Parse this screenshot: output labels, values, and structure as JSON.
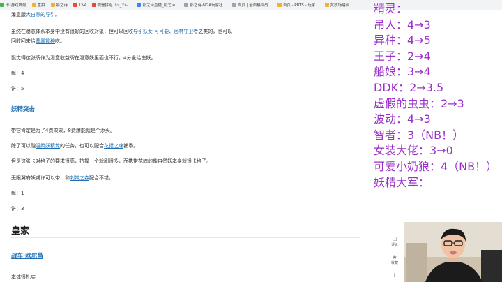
{
  "bookmarks": [
    {
      "label": "卡-游戏牌局",
      "color": "#4caf50"
    },
    {
      "label": "置拍",
      "color": "#f2b134"
    },
    {
      "label": "影之诗",
      "color": "#f2b134"
    },
    {
      "label": "TK2",
      "color": "#e04b3a"
    },
    {
      "label": "微信拼组（~_^)-...",
      "color": "#e04b3a"
    },
    {
      "label": "影之诗直播_影之诗...",
      "color": "#3b82f6"
    },
    {
      "label": "影之诗-NGA玩家社...",
      "color": "#9ca3af"
    },
    {
      "label": "首页 | 全面模拟战...",
      "color": "#9ca3af"
    },
    {
      "label": "首页 - PRTS - 玩家...",
      "color": "#f2b134"
    },
    {
      "label": "竞技场建议...",
      "color": "#f2b134"
    }
  ],
  "article": {
    "line1_pre": "瀑意版",
    "line1_link": "大自然的导引",
    "line1_post": "。",
    "line2_pre": "虽然在瀑意体系本身中没有很好的回收对象，但可以回收",
    "line2_link1": "导引妖女·可可要",
    "line2_mid": "、",
    "line2_link2": "密林守卫者",
    "line2_post": "之类的，也可以",
    "line3_pre": "回收回来给",
    "line3_link": "翡翠锁种",
    "line3_post": "吃。",
    "line4": "飘觉得这张牌作为瀑意收益牌在瀑意妖里面也不行，4分全给虫妖。",
    "score1a": "飘：4",
    "score1b": "饼：5",
    "section1": "妖精突击",
    "line5": "带它肯定是为了4费效果，8费爆能就是个添头。",
    "line6_pre": "除了可以融",
    "line6_link1": "温柔妖精龙",
    "line6_mid": "的任务，也可以配合",
    "line6_link2": "花猎之魂",
    "line6_post": "铺场。",
    "line7": "但是这张卡对格子的要求很高，抗操一个就刷很多，而携带花魂的像自然妖本身就很卡格子。",
    "line8_pre": "无限翼府妖或许可以带，和",
    "line8_link": "刺棘之森",
    "line8_post": "配合不错。",
    "score2a": "飘：1",
    "score2b": "饼：3",
    "section2": "皇家",
    "section3": "战车·欧尔昌",
    "line9": "本体很扎实"
  },
  "rail": [
    {
      "icon": "comment-icon",
      "glyph": "☐",
      "label": "评论"
    },
    {
      "icon": "star-icon",
      "glyph": "★",
      "label": "收藏"
    },
    {
      "icon": "share-icon",
      "glyph": "⇪",
      "label": "分享"
    }
  ],
  "overlay": [
    "精灵：",
    "吊人：4→3",
    "异种：4→5",
    "王子：2→4",
    "船娘：3→4",
    "DDK：2→3.5",
    "虚假的虫虫：2→3",
    "波动：4→3",
    "智者：3（NB！）",
    "女装大佬：3→0",
    "可爱小奶狼：4（NB！）",
    "妖精大军："
  ],
  "colors": {
    "overlay_text": "#9b30c8",
    "link": "#1f6fb2"
  }
}
